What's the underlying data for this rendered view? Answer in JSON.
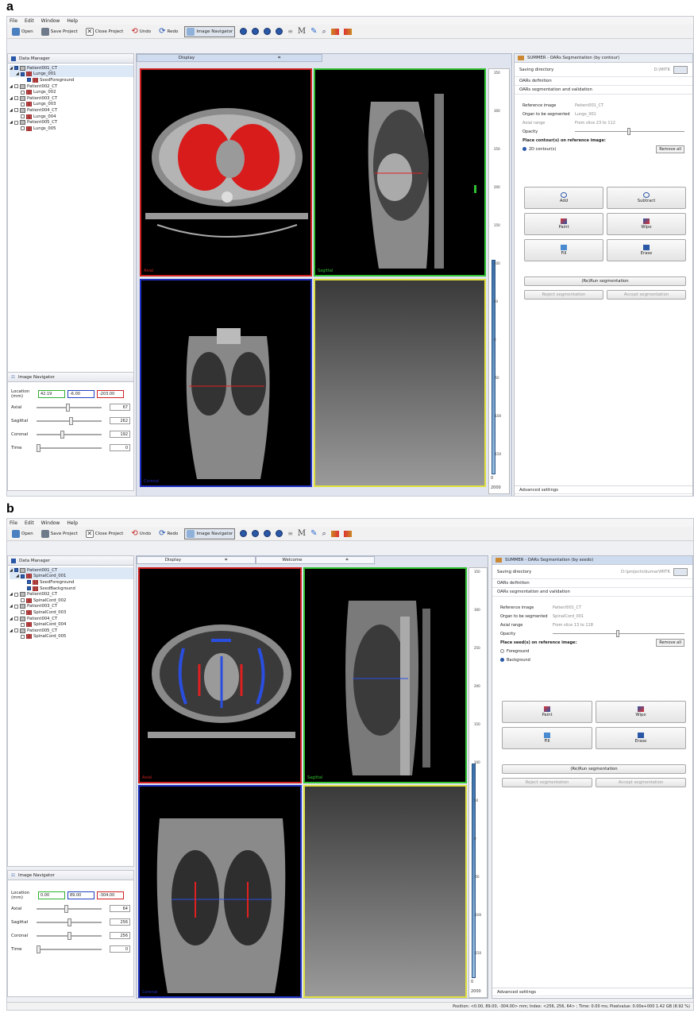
{
  "figure": {
    "label_a": "a",
    "label_b": "b"
  },
  "menu": [
    "File",
    "Edit",
    "Window",
    "Help"
  ],
  "toolbar": {
    "open": "Open",
    "save": "Save Project",
    "close": "Close Project",
    "undo": "Undo",
    "redo": "Redo",
    "image_navigator": "Image Navigator",
    "m_glyph": "M"
  },
  "panel_a": {
    "data_manager_title": "Data Manager",
    "tree": [
      "Patient001_CT",
      "Lungs_001",
      "SeedForeground",
      "Patient002_CT",
      "Lungs_002",
      "Patient003_CT",
      "Lungs_003",
      "Patient004_CT",
      "Lungs_004",
      "Patient005_CT",
      "Lungs_005"
    ],
    "display_tab": "Display",
    "views": {
      "axial": "Axial",
      "sagittal": "Sagittal",
      "coronal": "Coronal"
    },
    "colorbar_ticks": [
      "350",
      "300",
      "250",
      "200",
      "150",
      "100",
      "50",
      "0",
      "-50",
      "-100",
      "-150"
    ],
    "colorbar_bottom": [
      "0",
      "2000"
    ],
    "navigator": {
      "title": "Image Navigator",
      "location_label": "Location (mm)",
      "loc_x": "42.19",
      "loc_y": "-6.00",
      "loc_z": "-203.00",
      "axial_label": "Axial",
      "axial_val": "67",
      "sagittal_label": "Sagittal",
      "sagittal_val": "262",
      "coronal_label": "Coronal",
      "coronal_val": "192",
      "time_label": "Time",
      "time_val": "0"
    },
    "right_panel": {
      "title": "SUMMER - OARs Segmentation (by contour)",
      "saving_dir_label": "Saving directory",
      "saving_dir_value": "D:\\MITK",
      "oars_definition": "OARs definition",
      "oars_seg": "OARs segmentation and validation",
      "ref_image_label": "Reference image",
      "ref_image_value": "Patient001_CT",
      "organ_label": "Organ to be segmented",
      "organ_value": "Lungs_001",
      "axial_range_label": "Axial range",
      "axial_range_value": "From slice 23 to 112",
      "opacity_label": "Opacity",
      "place_label": "Place contour(s) on reference image:",
      "radio_2d": "2D contour(s)",
      "remove_all": "Remove all",
      "buttons": [
        "Add",
        "Subtract",
        "Paint",
        "Wipe",
        "Fill",
        "Erase"
      ],
      "rerun": "(Re)Run segmentation",
      "reject": "Reject segmentation",
      "accept": "Accept segmentation",
      "advanced": "Advanced settings"
    }
  },
  "panel_b": {
    "data_manager_title": "Data Manager",
    "tree": [
      "Patient001_CT",
      "SpinalCord_001",
      "SeedForeground",
      "SeedBackground",
      "Patient002_CT",
      "SpinalCord_002",
      "Patient003_CT",
      "SpinalCord_003",
      "Patient004_CT",
      "SpinalCord_004",
      "Patient005_CT",
      "SpinalCord_005"
    ],
    "display_tab": "Display",
    "welcome_tab": "Welcome",
    "views": {
      "axial": "Axial",
      "sagittal": "Sagittal",
      "coronal": "Coronal"
    },
    "colorbar_ticks": [
      "350",
      "300",
      "250",
      "200",
      "150",
      "100",
      "50",
      "0",
      "-50",
      "-100",
      "-150"
    ],
    "colorbar_bottom": [
      "0",
      "2000"
    ],
    "navigator": {
      "title": "Image Navigator",
      "location_label": "Location (mm)",
      "loc_x": "0.00",
      "loc_y": "89.00",
      "loc_z": "-304.00",
      "axial_label": "Axial",
      "axial_val": "64",
      "sagittal_label": "Sagittal",
      "sagittal_val": "256",
      "coronal_label": "Coronal",
      "coronal_val": "256",
      "time_label": "Time",
      "time_val": "0"
    },
    "right_panel": {
      "title": "SUMMER - OARs Segmentation (by seeds)",
      "saving_dir_label": "Saving directory",
      "saving_dir_value": "D:\\projects\\kumar\\MITK",
      "oars_definition": "OARs definition",
      "oars_seg": "OARs segmentation and validation",
      "ref_image_label": "Reference image",
      "ref_image_value": "Patient001_CT",
      "organ_label": "Organ to be segmented",
      "organ_value": "SpinalCord_001",
      "axial_range_label": "Axial range",
      "axial_range_value": "From slice 13 to 118",
      "opacity_label": "Opacity",
      "place_label": "Place seed(s) on reference image:",
      "radio_fg": "Foreground",
      "radio_bg": "Background",
      "remove_all": "Remove all",
      "buttons": [
        "Paint",
        "Wipe",
        "Fill",
        "Erase"
      ],
      "rerun": "(Re)Run segmentation",
      "reject": "Reject segmentation",
      "accept": "Accept segmentation",
      "advanced": "Advanced settings"
    },
    "status": "Position: <0.00, 89.00, -304.00> mm; Index: <256, 256, 64> ; Time: 0.00 ms; Pixelvalue: 0.00e+000   1.42 GB (8.92 %)"
  },
  "colors": {
    "accent_red": "#e02020",
    "accent_blue": "#2a4ee0",
    "axial_border": "#d02020",
    "sagittal_border": "#30c030",
    "coronal_border": "#2030c0",
    "fourth_border": "#e0e040"
  }
}
